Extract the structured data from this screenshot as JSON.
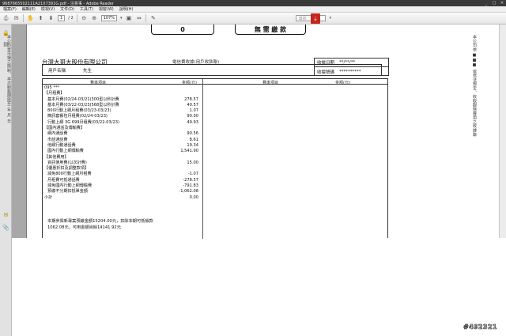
{
  "window": {
    "title": "9687665502111A21X7391G.pdf - 注意事 - Adobe Reader",
    "controls": [
      "_",
      "□",
      "✕"
    ]
  },
  "menu": [
    "檔案(F)",
    "編輯(E)",
    "檢視(V)",
    "文件(D)",
    "工具(T)",
    "視窗(W)",
    "說明(H)"
  ],
  "toolbar": {
    "page_current": "1",
    "page_total": "/ 2",
    "zoom": "107%",
    "find_placeholder": "尋找"
  },
  "page_top": {
    "box1": "0",
    "box2": "無 需 繳 款"
  },
  "side_left": "本公司受市場之限制、本次服務期限至 年 月 日",
  "side_right": "本公司依 ■■■ 電信法規定、收取服務費用之收據聯",
  "doc": {
    "company": "台灣大哥大股份有限公司",
    "doc_type": "電信費收據(用戶收執聯)",
    "user_label": "用戶名稱",
    "user_value": "先生",
    "meta": [
      {
        "label": "收據日期",
        "value": "**/**/**"
      },
      {
        "label": "收據號碼",
        "value": "**********"
      }
    ],
    "table_head": {
      "item": "費率項目",
      "amount": "金額(元)",
      "item2": "費率項目",
      "amount2": "金額(元)"
    },
    "rows": [
      {
        "label": "095 ***",
        "value": "",
        "indent": false
      },
      {
        "label": "【月租費】",
        "value": "",
        "indent": false
      },
      {
        "label": "基本月費(02/24-03/21)300型以秒計費",
        "value": "278.57",
        "indent": true
      },
      {
        "label": "基本月費(03/22-03/23)568型以秒計費",
        "value": "40.57",
        "indent": true
      },
      {
        "label": "800行動上網月租費(03/23-03/23)",
        "value": "1.07",
        "indent": true
      },
      {
        "label": "簡訊套餐包月租費(02/24-03/23)",
        "value": "90.00",
        "indent": true
      },
      {
        "label": "行動上網 3G 699月租費(03/22-03/23)",
        "value": "49.93",
        "indent": true
      },
      {
        "label": "【國內通話及傳輸費】",
        "value": "",
        "indent": false
      },
      {
        "label": "網內通話費",
        "value": "90.56",
        "indent": true
      },
      {
        "label": "市話通話費",
        "value": "8.61",
        "indent": true
      },
      {
        "label": "他網行動通話費",
        "value": "19.34",
        "indent": true
      },
      {
        "label": "國內行動上網傳輸費",
        "value": "1,541.90",
        "indent": true
      },
      {
        "label": "【其他費用】",
        "value": "",
        "indent": false
      },
      {
        "label": "資訊使用費(以次計費)",
        "value": "15.00",
        "indent": true
      },
      {
        "label": "【優惠折扣及調整款項】",
        "value": "",
        "indent": false
      },
      {
        "label": "減免800行動上網月租費",
        "value": "-1.07",
        "indent": true
      },
      {
        "label": "月租費可抵通話費",
        "value": "-278.57",
        "indent": true
      },
      {
        "label": "減免國內行動上網傳輸費",
        "value": "-791.83",
        "indent": true
      },
      {
        "label": "預繳不分期扣抵單金額",
        "value": "-1,062.08",
        "indent": true
      },
      {
        "label": "小計",
        "value": "0.00",
        "indent": false
      }
    ],
    "note_line1": "本期參與新專案預繳金額15204.00元，扣除本期可抵帳款",
    "note_line2": "1062.08元，可用金額尚餘14141.92元"
  },
  "watermark": "#492321"
}
